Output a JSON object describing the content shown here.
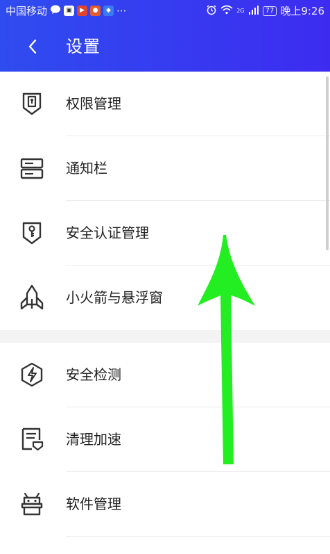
{
  "status_bar": {
    "carrier": "中国移动",
    "network": "2G",
    "battery": "77",
    "time": "晚上9:26",
    "more": "···"
  },
  "header": {
    "title": "设置"
  },
  "menu": [
    {
      "label": "权限管理",
      "icon": "shield-keyhole-icon"
    },
    {
      "label": "通知栏",
      "icon": "notification-bar-icon"
    },
    {
      "label": "安全认证管理",
      "icon": "shield-key-icon"
    },
    {
      "label": "小火箭与悬浮窗",
      "icon": "rocket-icon"
    },
    {
      "label": "安全检测",
      "icon": "shield-bolt-icon"
    },
    {
      "label": "清理加速",
      "icon": "document-clean-icon"
    },
    {
      "label": "软件管理",
      "icon": "android-robot-icon"
    }
  ],
  "colors": {
    "header": "#3340f0",
    "arrow": "#22ee22"
  }
}
